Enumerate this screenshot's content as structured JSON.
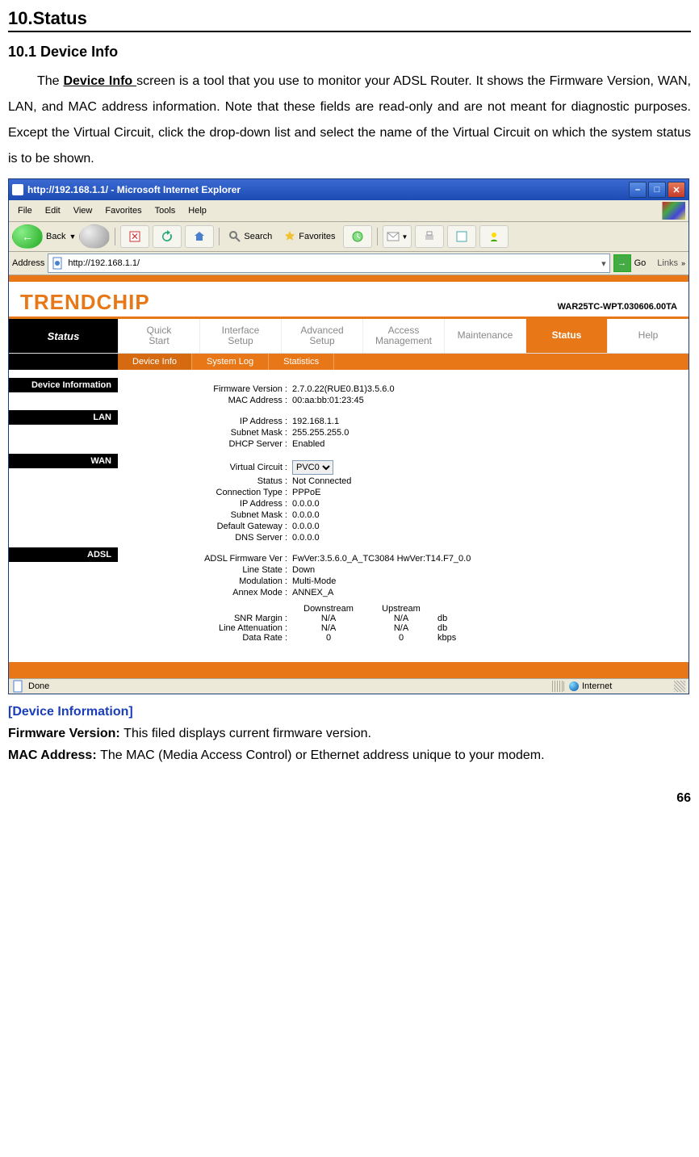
{
  "doc": {
    "heading": "10.Status",
    "subheading": "10.1 Device Info",
    "paragraph_pre": "The ",
    "device_info_text": "Device Info ",
    "paragraph_post": "screen is a tool that you use to monitor your ADSL Router. It shows the Firmware Version, WAN, LAN, and MAC address information. Note that these fields are read-only and are not meant for diagnostic purposes. Except the Virtual Circuit, click the drop-down list and select the name of the Virtual Circuit on which the system status is to be shown.",
    "bottom_head": "[Device Information]",
    "fw_label": "Firmware Version: ",
    "fw_text": "This filed displays current firmware version.",
    "mac_label": "MAC Address: ",
    "mac_text": "The MAC (Media Access Control) or Ethernet address unique to your modem.",
    "page_number": "66"
  },
  "ie": {
    "title": "http://192.168.1.1/ - Microsoft Internet Explorer",
    "menus": [
      "File",
      "Edit",
      "View",
      "Favorites",
      "Tools",
      "Help"
    ],
    "back": "Back",
    "search": "Search",
    "favorites": "Favorites",
    "address_label": "Address",
    "url": "http://192.168.1.1/",
    "go": "Go",
    "links": "Links",
    "status_done": "Done",
    "status_zone": "Internet"
  },
  "router": {
    "brand": "TRENDCHIP",
    "fw_id": "WAR25TC-WPT.030606.00TA",
    "left_label": "Status",
    "tabs": {
      "quick": "Quick\nStart",
      "iface": "Interface\nSetup",
      "adv": "Advanced\nSetup",
      "access": "Access\nManagement",
      "maint": "Maintenance",
      "status": "Status",
      "help": "Help"
    },
    "subtabs": {
      "dev": "Device Info",
      "log": "System Log",
      "stat": "Statistics"
    },
    "section_devinfo": "Device Information",
    "fields_devinfo": {
      "fw": {
        "k": "Firmware Version :",
        "v": "2.7.0.22(RUE0.B1)3.5.6.0"
      },
      "mac": {
        "k": "MAC Address :",
        "v": "00:aa:bb:01:23:45"
      }
    },
    "section_lan": "LAN",
    "fields_lan": {
      "ip": {
        "k": "IP Address :",
        "v": "192.168.1.1"
      },
      "mask": {
        "k": "Subnet Mask :",
        "v": "255.255.255.0"
      },
      "dhcp": {
        "k": "DHCP Server :",
        "v": "Enabled"
      }
    },
    "section_wan": "WAN",
    "fields_wan": {
      "vc": {
        "k": "Virtual Circuit :",
        "v": "PVC0"
      },
      "status": {
        "k": "Status :",
        "v": "Not Connected"
      },
      "ctype": {
        "k": "Connection Type :",
        "v": "PPPoE"
      },
      "ip": {
        "k": "IP Address :",
        "v": "0.0.0.0"
      },
      "mask": {
        "k": "Subnet Mask :",
        "v": "0.0.0.0"
      },
      "gw": {
        "k": "Default Gateway :",
        "v": "0.0.0.0"
      },
      "dns": {
        "k": "DNS Server :",
        "v": "0.0.0.0"
      }
    },
    "section_adsl": "ADSL",
    "fields_adsl": {
      "fw": {
        "k": "ADSL Firmware Ver :",
        "v": "FwVer:3.5.6.0_A_TC3084 HwVer:T14.F7_0.0"
      },
      "state": {
        "k": "Line State :",
        "v": "Down"
      },
      "mod": {
        "k": "Modulation :",
        "v": "Multi-Mode"
      },
      "annex": {
        "k": "Annex Mode :",
        "v": "ANNEX_A"
      }
    },
    "adsl_table": {
      "headers": {
        "down": "Downstream",
        "up": "Upstream"
      },
      "rows": [
        {
          "k": "SNR Margin :",
          "d": "N/A",
          "u": "N/A",
          "unit": "db"
        },
        {
          "k": "Line Attenuation :",
          "d": "N/A",
          "u": "N/A",
          "unit": "db"
        },
        {
          "k": "Data Rate :",
          "d": "0",
          "u": "0",
          "unit": "kbps"
        }
      ]
    }
  }
}
